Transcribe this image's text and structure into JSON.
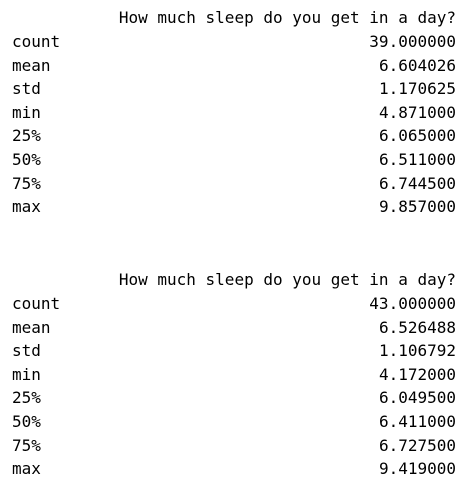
{
  "outputs": [
    {
      "header": "How much sleep do you get in a day?",
      "rows": [
        {
          "label": "count",
          "value": "39.000000"
        },
        {
          "label": "mean",
          "value": "6.604026"
        },
        {
          "label": "std",
          "value": "1.170625"
        },
        {
          "label": "min",
          "value": "4.871000"
        },
        {
          "label": "25%",
          "value": "6.065000"
        },
        {
          "label": "50%",
          "value": "6.511000"
        },
        {
          "label": "75%",
          "value": "6.744500"
        },
        {
          "label": "max",
          "value": "9.857000"
        }
      ]
    },
    {
      "header": "How much sleep do you get in a day?",
      "rows": [
        {
          "label": "count",
          "value": "43.000000"
        },
        {
          "label": "mean",
          "value": "6.526488"
        },
        {
          "label": "std",
          "value": "1.106792"
        },
        {
          "label": "min",
          "value": "4.172000"
        },
        {
          "label": "25%",
          "value": "6.049500"
        },
        {
          "label": "50%",
          "value": "6.411000"
        },
        {
          "label": "75%",
          "value": "6.727500"
        },
        {
          "label": "max",
          "value": "9.419000"
        }
      ]
    }
  ]
}
